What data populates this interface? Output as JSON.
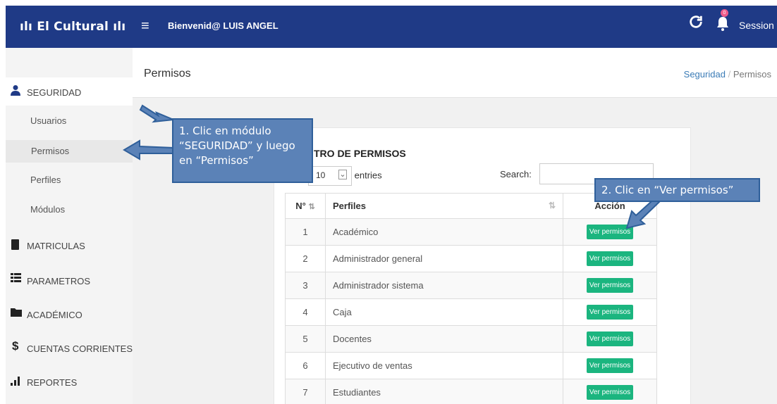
{
  "topbar": {
    "brand": "ılı El Cultural ılı",
    "menu_icon": "≡",
    "welcome": "Bienvenid@ LUIS ANGEL",
    "session": "Session ▾",
    "notification_count": "0",
    "bar_color": "#1f3a86"
  },
  "sidebar": {
    "items": [
      {
        "label": "SEGURIDAD",
        "icon": "user-icon"
      },
      {
        "label": "MATRICULAS",
        "icon": "book-icon"
      },
      {
        "label": "PARAMETROS",
        "icon": "list-icon"
      },
      {
        "label": "ACADÉMICO",
        "icon": "folder-icon"
      },
      {
        "label": "CUENTAS CORRIENTES",
        "icon": "dollar-icon"
      },
      {
        "label": "REPORTES",
        "icon": "bar-chart-icon"
      }
    ],
    "subitems": [
      "Usuarios",
      "Permisos",
      "Perfiles",
      "Módulos"
    ]
  },
  "main": {
    "title": "Permisos",
    "breadcrumb": {
      "parent": "Seguridad",
      "sep": "/",
      "current": "Permisos"
    },
    "card_title": "TRO DE PERMISOS",
    "length_value": "10",
    "entries_label": "entries",
    "search_label": "Search:",
    "table": {
      "headers": [
        "N°",
        "Perfiles",
        "Acción"
      ],
      "rows": [
        {
          "num": "1",
          "perfil": "Académico",
          "action": "Ver permisos"
        },
        {
          "num": "2",
          "perfil": "Administrador general",
          "action": "Ver permisos"
        },
        {
          "num": "3",
          "perfil": "Administrador sistema",
          "action": "Ver permisos"
        },
        {
          "num": "4",
          "perfil": "Caja",
          "action": "Ver permisos"
        },
        {
          "num": "5",
          "perfil": "Docentes",
          "action": "Ver permisos"
        },
        {
          "num": "6",
          "perfil": "Ejecutivo de ventas",
          "action": "Ver permisos"
        },
        {
          "num": "7",
          "perfil": "Estudiantes",
          "action": "Ver permisos"
        }
      ]
    }
  },
  "annotations": {
    "step1": "1. Clic en módulo “SEGURIDAD” y luego en “Permisos”",
    "step2": "2. Clic en “Ver permisos”"
  },
  "colors": {
    "accent_button": "#1bb57f",
    "callout_fill": "#5b82b7"
  }
}
